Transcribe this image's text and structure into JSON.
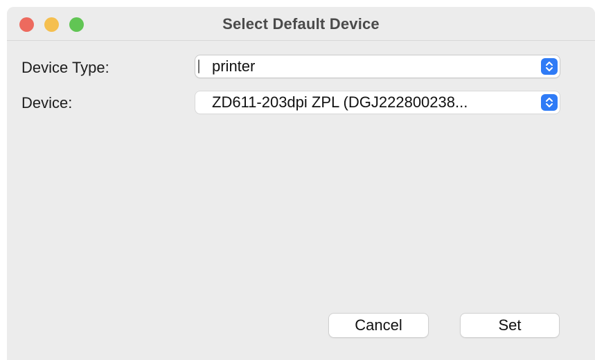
{
  "window": {
    "title": "Select Default Device"
  },
  "form": {
    "device_type_label": "Device Type:",
    "device_type_value": "printer",
    "device_label": "Device:",
    "device_value": "ZD611-203dpi ZPL (DGJ222800238..."
  },
  "buttons": {
    "cancel_label": "Cancel",
    "set_label": "Set"
  },
  "colors": {
    "accent": "#2f7bf6",
    "close": "#ed6a5e",
    "minimize": "#f5bf4f",
    "zoom": "#61c554"
  },
  "icons": {
    "stepper": "chevron-up-down-icon"
  }
}
